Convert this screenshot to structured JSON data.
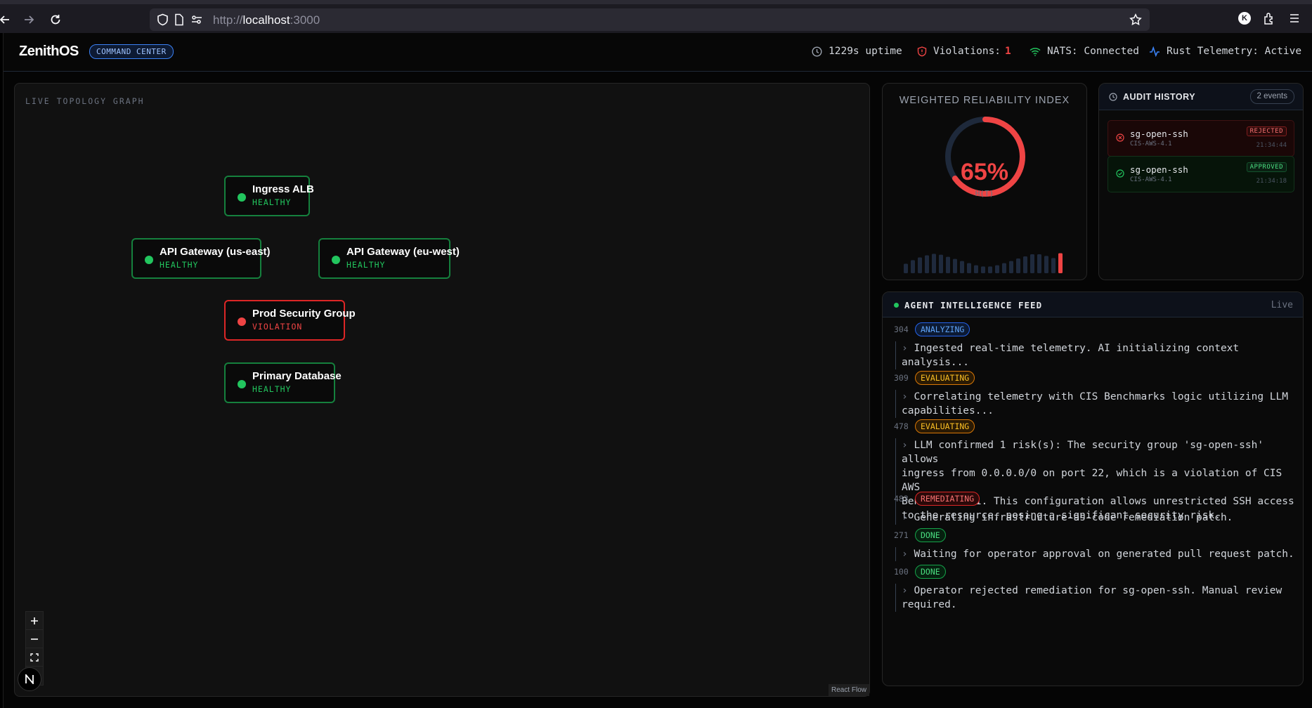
{
  "browser": {
    "url_prefix": "http://",
    "url_host": "localhost",
    "url_port": ":3000",
    "profile_letter": "K"
  },
  "header": {
    "brand": "ZenithOS",
    "badge": "COMMAND CENTER",
    "uptime": "1229s uptime",
    "violations_label": "Violations:",
    "violations_count": "1",
    "nats": "NATS: Connected",
    "telemetry": "Rust Telemetry: Active"
  },
  "topology": {
    "title": "LIVE TOPOLOGY GRAPH",
    "nodes": [
      {
        "name": "Ingress ALB",
        "status": "HEALTHY"
      },
      {
        "name": "API Gateway (us-east)",
        "status": "HEALTHY"
      },
      {
        "name": "API Gateway (eu-west)",
        "status": "HEALTHY"
      },
      {
        "name": "Prod Security Group",
        "status": "VIOLATION"
      },
      {
        "name": "Primary Database",
        "status": "HEALTHY"
      }
    ],
    "attribution": "React Flow"
  },
  "reliability": {
    "title": "WEIGHTED RELIABILITY INDEX",
    "value_text": "65%",
    "value": 0.65,
    "subtitle": "H(T)",
    "history": [
      0.45,
      0.62,
      0.75,
      0.85,
      0.92,
      0.88,
      0.78,
      0.68,
      0.58,
      0.48,
      0.38,
      0.32,
      0.32,
      0.38,
      0.48,
      0.58,
      0.7,
      0.8,
      0.9,
      0.9,
      0.82,
      0.72,
      0.95
    ],
    "accent": "#ef4444"
  },
  "audit": {
    "title": "AUDIT HISTORY",
    "count": "2 events",
    "events": [
      {
        "resource": "sg-open-ssh",
        "rule": "CIS-AWS-4.1",
        "status": "REJECTED",
        "time": "21:34:44"
      },
      {
        "resource": "sg-open-ssh",
        "rule": "CIS-AWS-4.1",
        "status": "APPROVED",
        "time": "21:34:18"
      }
    ]
  },
  "feed": {
    "title": "AGENT INTELLIGENCE FEED",
    "live": "Live",
    "entries": [
      {
        "id": "304",
        "stage": "ANALYZING",
        "message": "Ingested real-time telemetry. AI initializing context\nanalysis..."
      },
      {
        "id": "309",
        "stage": "EVALUATING",
        "message": "Correlating telemetry with CIS Benchmarks logic utilizing LLM\ncapabilities..."
      },
      {
        "id": "478",
        "stage": "EVALUATING",
        "message": "LLM confirmed 1 risk(s): The security group 'sg-open-ssh' allows\ningress from 0.0.0.0/0 on port 22, which is a violation of CIS AWS\nBenchmark 4.1. This configuration allows unrestricted SSH access\nto the resource, posing a significant security risk."
      },
      {
        "id": "483",
        "stage": "REMEDIATING",
        "message": "Generating infrastructure-as-code remediation patch."
      },
      {
        "id": "271",
        "stage": "DONE",
        "message": "Waiting for operator approval on generated pull request patch."
      },
      {
        "id": "100",
        "stage": "DONE",
        "message": "Operator rejected remediation for sg-open-ssh. Manual review\nrequired."
      }
    ]
  }
}
